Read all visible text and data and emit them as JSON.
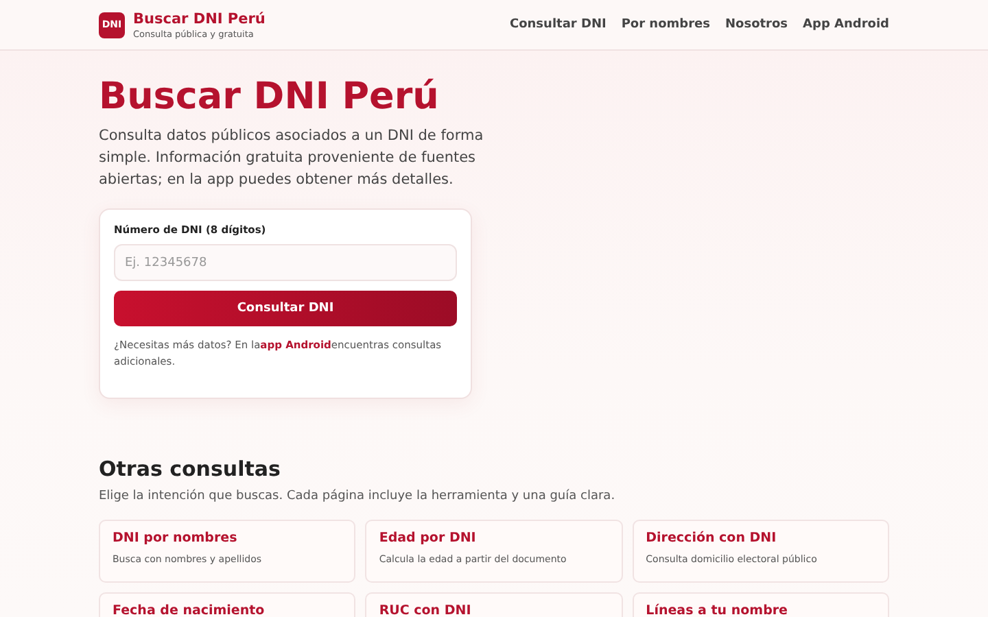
{
  "header": {
    "logo": "DNI",
    "title": "Buscar DNI Perú",
    "subtitle": "Consulta pública y gratuita",
    "nav": [
      "Consultar DNI",
      "Por nombres",
      "Nosotros",
      "App Android"
    ]
  },
  "hero": {
    "title": "Buscar DNI Perú",
    "intro": "Consulta datos públicos asociados a un DNI de forma simple. Información gratuita proveniente de fuentes abiertas; en la app puedes obtener más detalles."
  },
  "form": {
    "label": "Número de DNI (8 dígitos)",
    "placeholder": "Ej. 12345678",
    "button": "Consultar DNI",
    "note_before": "¿Necesitas más datos? En la",
    "note_link": "app Android",
    "note_after": "encuentras consultas adicionales."
  },
  "other": {
    "title": "Otras consultas",
    "subtitle": "Elige la intención que buscas. Cada página incluye la herramienta y una guía clara.",
    "cards": [
      {
        "title": "DNI por nombres",
        "description": "Busca con nombres y apellidos"
      },
      {
        "title": "Edad por DNI",
        "description": "Calcula la edad a partir del documento"
      },
      {
        "title": "Dirección con DNI",
        "description": "Consulta domicilio electoral público"
      },
      {
        "title": "Fecha de nacimiento"
      },
      {
        "title": "RUC con DNI"
      },
      {
        "title": "Líneas a tu nombre"
      }
    ]
  }
}
